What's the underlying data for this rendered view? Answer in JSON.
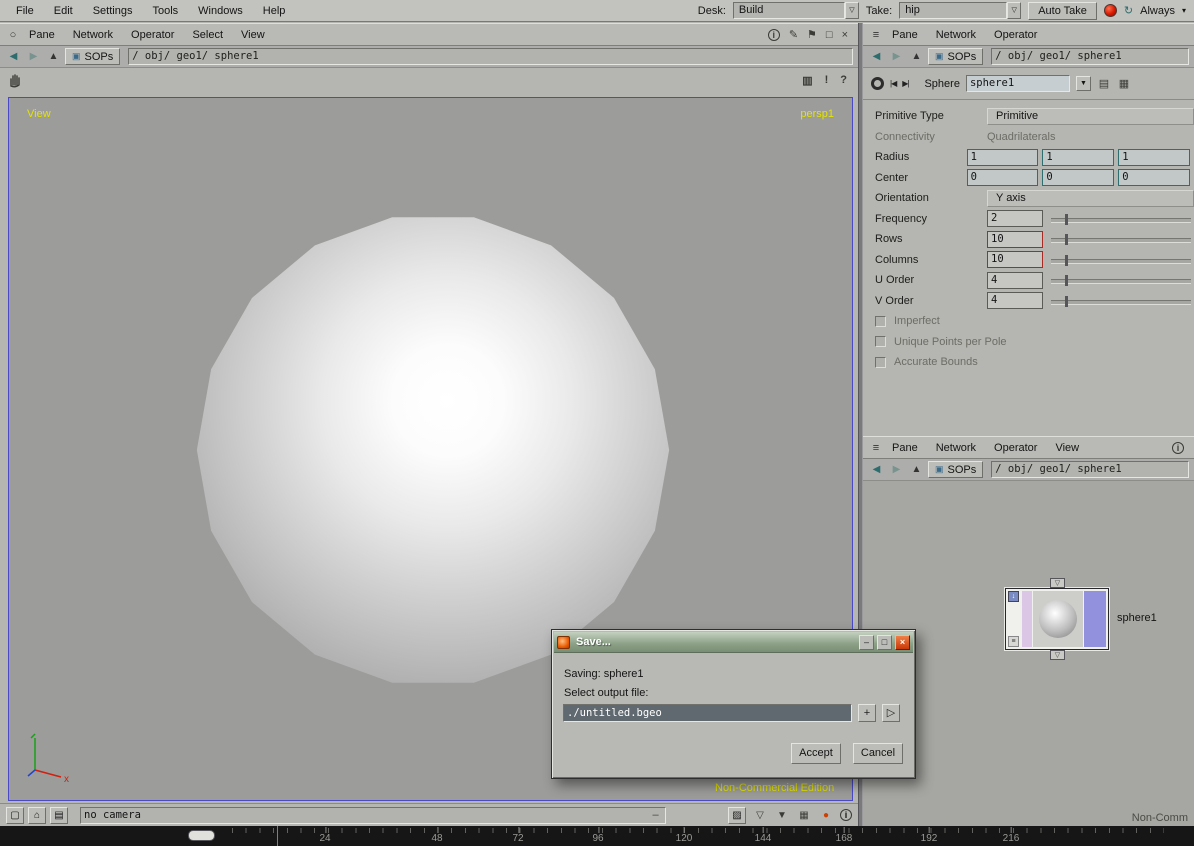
{
  "menubar": {
    "items": [
      "File",
      "Edit",
      "Settings",
      "Tools",
      "Windows",
      "Help"
    ],
    "desk_label": "Desk:",
    "desk_value": "Build",
    "take_label": "Take:",
    "take_value": "hip",
    "auto_take_label": "Auto Take",
    "always_label": "Always"
  },
  "nav": {
    "context_label": "SOPs",
    "path": "/ obj/ geo1/ sphere1"
  },
  "left_pane": {
    "menu": [
      "Pane",
      "Network",
      "Operator",
      "Select",
      "View"
    ],
    "viewport_label": "View",
    "camera_name": "persp1",
    "watermark": "Non-Commercial Edition",
    "camera_field": "no camera"
  },
  "params_pane": {
    "menu": [
      "Pane",
      "Network",
      "Operator"
    ],
    "op_type_label": "Sphere",
    "op_name": "sphere1",
    "params": [
      {
        "label": "Primitive Type",
        "value": "Primitive"
      },
      {
        "label": "Connectivity",
        "value": "Quadrilaterals"
      },
      {
        "label": "Radius",
        "values": [
          "1",
          "1",
          "1"
        ]
      },
      {
        "label": "Center",
        "values": [
          "0",
          "0",
          "0"
        ]
      },
      {
        "label": "Orientation",
        "value": "Y axis"
      },
      {
        "label": "Frequency",
        "value": "2"
      },
      {
        "label": "Rows",
        "value": "10"
      },
      {
        "label": "Columns",
        "value": "10"
      },
      {
        "label": "U Order",
        "value": "4"
      },
      {
        "label": "V Order",
        "value": "4"
      },
      {
        "label": "Imperfect"
      },
      {
        "label": "Unique Points per Pole"
      },
      {
        "label": "Accurate Bounds"
      }
    ]
  },
  "network_pane": {
    "menu": [
      "Pane",
      "Network",
      "Operator",
      "View"
    ],
    "node_name": "sphere1",
    "watermark": "Non-Comm"
  },
  "save_dialog": {
    "title": "Save...",
    "saving_line": "Saving: sphere1",
    "prompt": "Select output file:",
    "file_value": "./untitled.bgeo",
    "accept_label": "Accept",
    "cancel_label": "Cancel"
  },
  "timeline": {
    "ticks": [
      "24",
      "48",
      "72",
      "96",
      "120",
      "144",
      "168",
      "192",
      "216"
    ]
  },
  "icons": {
    "pane_circle": "○",
    "hamburger": "≡",
    "back": "◀",
    "forward": "▶",
    "up": "▲",
    "network": "▣",
    "info": "i",
    "edit": "✎",
    "pin": "⚑",
    "maximize": "□",
    "close": "×",
    "export": "▥",
    "exclaim": "!",
    "help": "?",
    "skip_start": "|◀",
    "skip_end": "▶|",
    "menu_arrow": "▼",
    "dropdown": "▽",
    "copy": "▤",
    "layers": "▦",
    "plus": "+",
    "play": "▷",
    "minimize": "–",
    "restore": "□",
    "record": "",
    "refresh": "↻",
    "caret": "▾",
    "display": "▢",
    "home": "⌂",
    "snapshot": "▤",
    "dash": "–",
    "flipbook": "▨",
    "flag": "▽",
    "funnel": "▼",
    "grid": "▦",
    "droplet": "●",
    "down": "↓",
    "conn": "▽"
  }
}
